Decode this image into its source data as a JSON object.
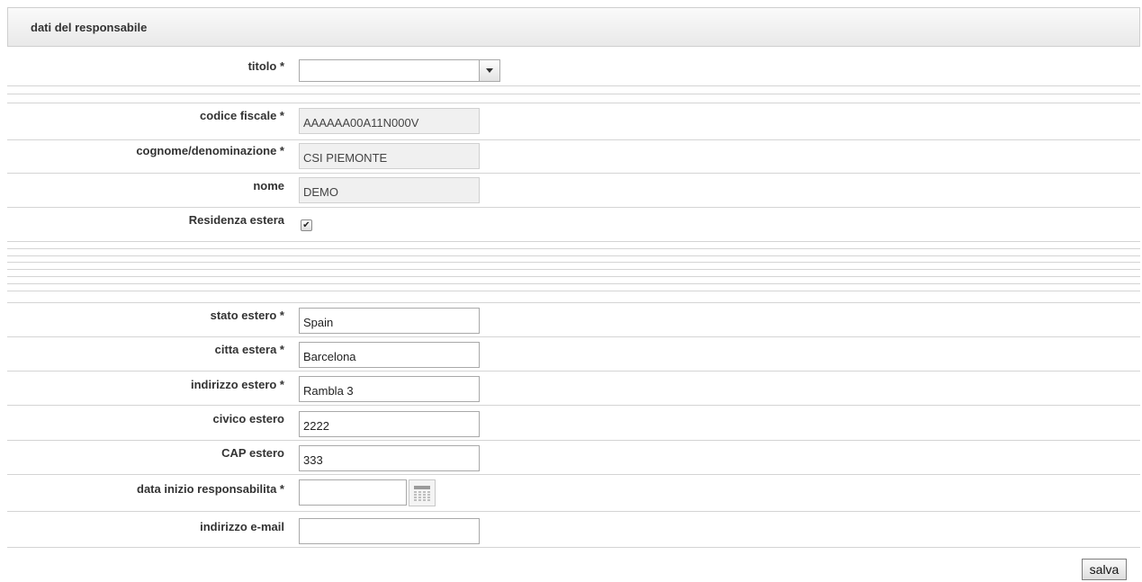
{
  "section": {
    "title": "dati del responsabile"
  },
  "form": {
    "titolo": {
      "label": "titolo *",
      "value": ""
    },
    "codice_fiscale": {
      "label": "codice fiscale *",
      "value": "AAAAAA00A11N000V"
    },
    "cognome": {
      "label": "cognome/denominazione *",
      "value": "CSI PIEMONTE"
    },
    "nome": {
      "label": "nome",
      "value": "DEMO"
    },
    "residenza_estera": {
      "label": "Residenza estera",
      "checked": true,
      "mark": "✔"
    },
    "stato_estero": {
      "label": "stato estero *",
      "value": "Spain"
    },
    "citta_estera": {
      "label": "citta estera *",
      "value": "Barcelona"
    },
    "indirizzo_estero": {
      "label": "indirizzo estero *",
      "value": "Rambla 3"
    },
    "civico_estero": {
      "label": "civico estero",
      "value": "2222"
    },
    "cap_estero": {
      "label": "CAP estero",
      "value": "333"
    },
    "data_inizio": {
      "label": "data inizio responsabilita *",
      "value": ""
    },
    "email": {
      "label": "indirizzo e-mail",
      "value": ""
    }
  },
  "actions": {
    "save_label": "salva"
  },
  "icons": {
    "select_arrow": "chevron-down-icon",
    "calendar": "calendar-icon",
    "checkbox_mark": "check-icon"
  }
}
